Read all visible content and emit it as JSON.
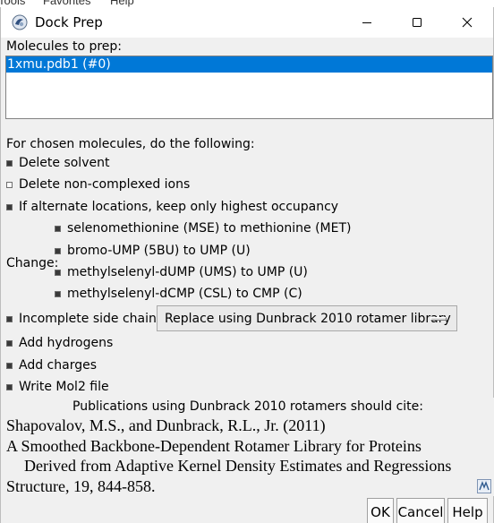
{
  "background_menu": [
    "Tools",
    "Favorites",
    "Help"
  ],
  "window": {
    "title": "Dock Prep",
    "controls": [
      "minimize-icon",
      "maximize-icon",
      "close-icon"
    ]
  },
  "molecules": {
    "label": "Molecules to prep:",
    "items": [
      "1xmu.pdb1 (#0)"
    ],
    "selected_color": "#0078d7"
  },
  "options": {
    "header": "For chosen molecules, do the following:",
    "delete_solvent": {
      "label": "Delete solvent",
      "checked": true
    },
    "delete_ions": {
      "label": "Delete non-complexed ions",
      "checked": false
    },
    "alt_locations": {
      "label": "If alternate locations, keep only highest occupancy",
      "checked": true
    },
    "change_label": "Change:",
    "change_items": [
      {
        "label": "selenomethionine (MSE) to methionine (MET)",
        "checked": true
      },
      {
        "label": "bromo-UMP (5BU) to UMP (U)",
        "checked": true
      },
      {
        "label": "methylselenyl-dUMP (UMS) to UMP (U)",
        "checked": true
      },
      {
        "label": "methylselenyl-dCMP (CSL) to CMP (C)",
        "checked": true
      }
    ],
    "side_chains": {
      "label": "Incomplete side chains:",
      "checked": true,
      "selected": "Replace using Dunbrack 2010 rotamer library"
    },
    "add_hydrogens": {
      "label": "Add hydrogens",
      "checked": true
    },
    "add_charges": {
      "label": "Add charges",
      "checked": true
    },
    "write_mol2": {
      "label": "Write Mol2 file",
      "checked": true
    }
  },
  "citation": {
    "header": "Publications using Dunbrack 2010 rotamers should cite:",
    "lines": [
      "Shapovalov, M.S., and Dunbrack, R.L., Jr. (2011)",
      "A Smoothed Backbone-Dependent Rotamer Library for Proteins",
      "Derived from Adaptive Kernel Density Estimates and Regressions",
      "Structure, 19, 844-858."
    ]
  },
  "buttons": {
    "ok": "OK",
    "cancel": "Cancel",
    "help": "Help"
  }
}
